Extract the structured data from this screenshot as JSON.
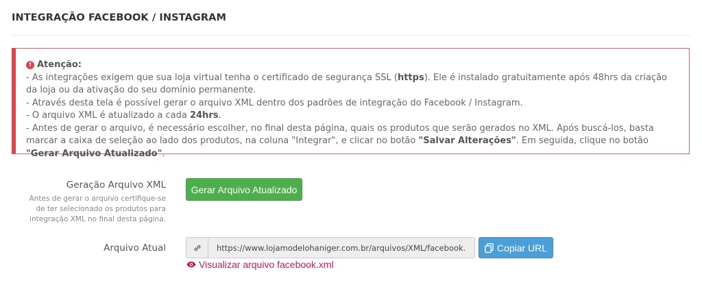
{
  "page": {
    "title": "INTEGRAÇÃO FACEBOOK / INSTAGRAM"
  },
  "alert": {
    "heading": "Atenção:",
    "line1": {
      "a": "- As integrações exigem que sua loja virtual tenha o certificado de segurança SSL (",
      "b": "https",
      "c": "). Ele é instalado gratuitamente após 48hrs da criação da loja ou da ativação do seu domínio permanente."
    },
    "line2": "- Através desta tela é possível gerar o arquivo XML dentro dos padrões de integração do Facebook / Instagram.",
    "line3": {
      "a": "- O arquivo XML é atualizado a cada ",
      "b": "24hrs",
      "c": "."
    },
    "line4": {
      "a": "- Antes de gerar o arquivo, é necessário escolher, no final desta página, quais os produtos que serão gerados no XML. Após buscá-los, basta marcar a caixa de seleção ao lado dos produtos, na coluna \"Integrar\", e clicar no botão ",
      "b": "\"Salvar Alterações\"",
      "c": ". Em seguida, clique no botão ",
      "d": "\"Gerar Arquivo Atualizado\"",
      "e": "."
    },
    "icon": "exclamation-circle-icon",
    "color": "#e0434b"
  },
  "xml_generation": {
    "label": "Geração Arquivo XML",
    "help": "Antes de gerar o arquivo certifique-se de ter selecionado os produtos para integração XML no final desta página.",
    "button_label": "Gerar Arquivo Atualizado",
    "button_color": "#4cae4c"
  },
  "current_file": {
    "label": "Arquivo Atual",
    "url": "https://www.lojamodelohaniger.com.br/arquivos/XML/facebook.XML",
    "link_icon": "link-icon",
    "copy_button_label": "Copiar URL",
    "copy_icon": "copy-icon",
    "copy_color": "#4a9fd8",
    "view_link_label": "Visualizar arquivo facebook.xml",
    "view_icon": "eye-icon",
    "view_color": "#c2185b"
  }
}
